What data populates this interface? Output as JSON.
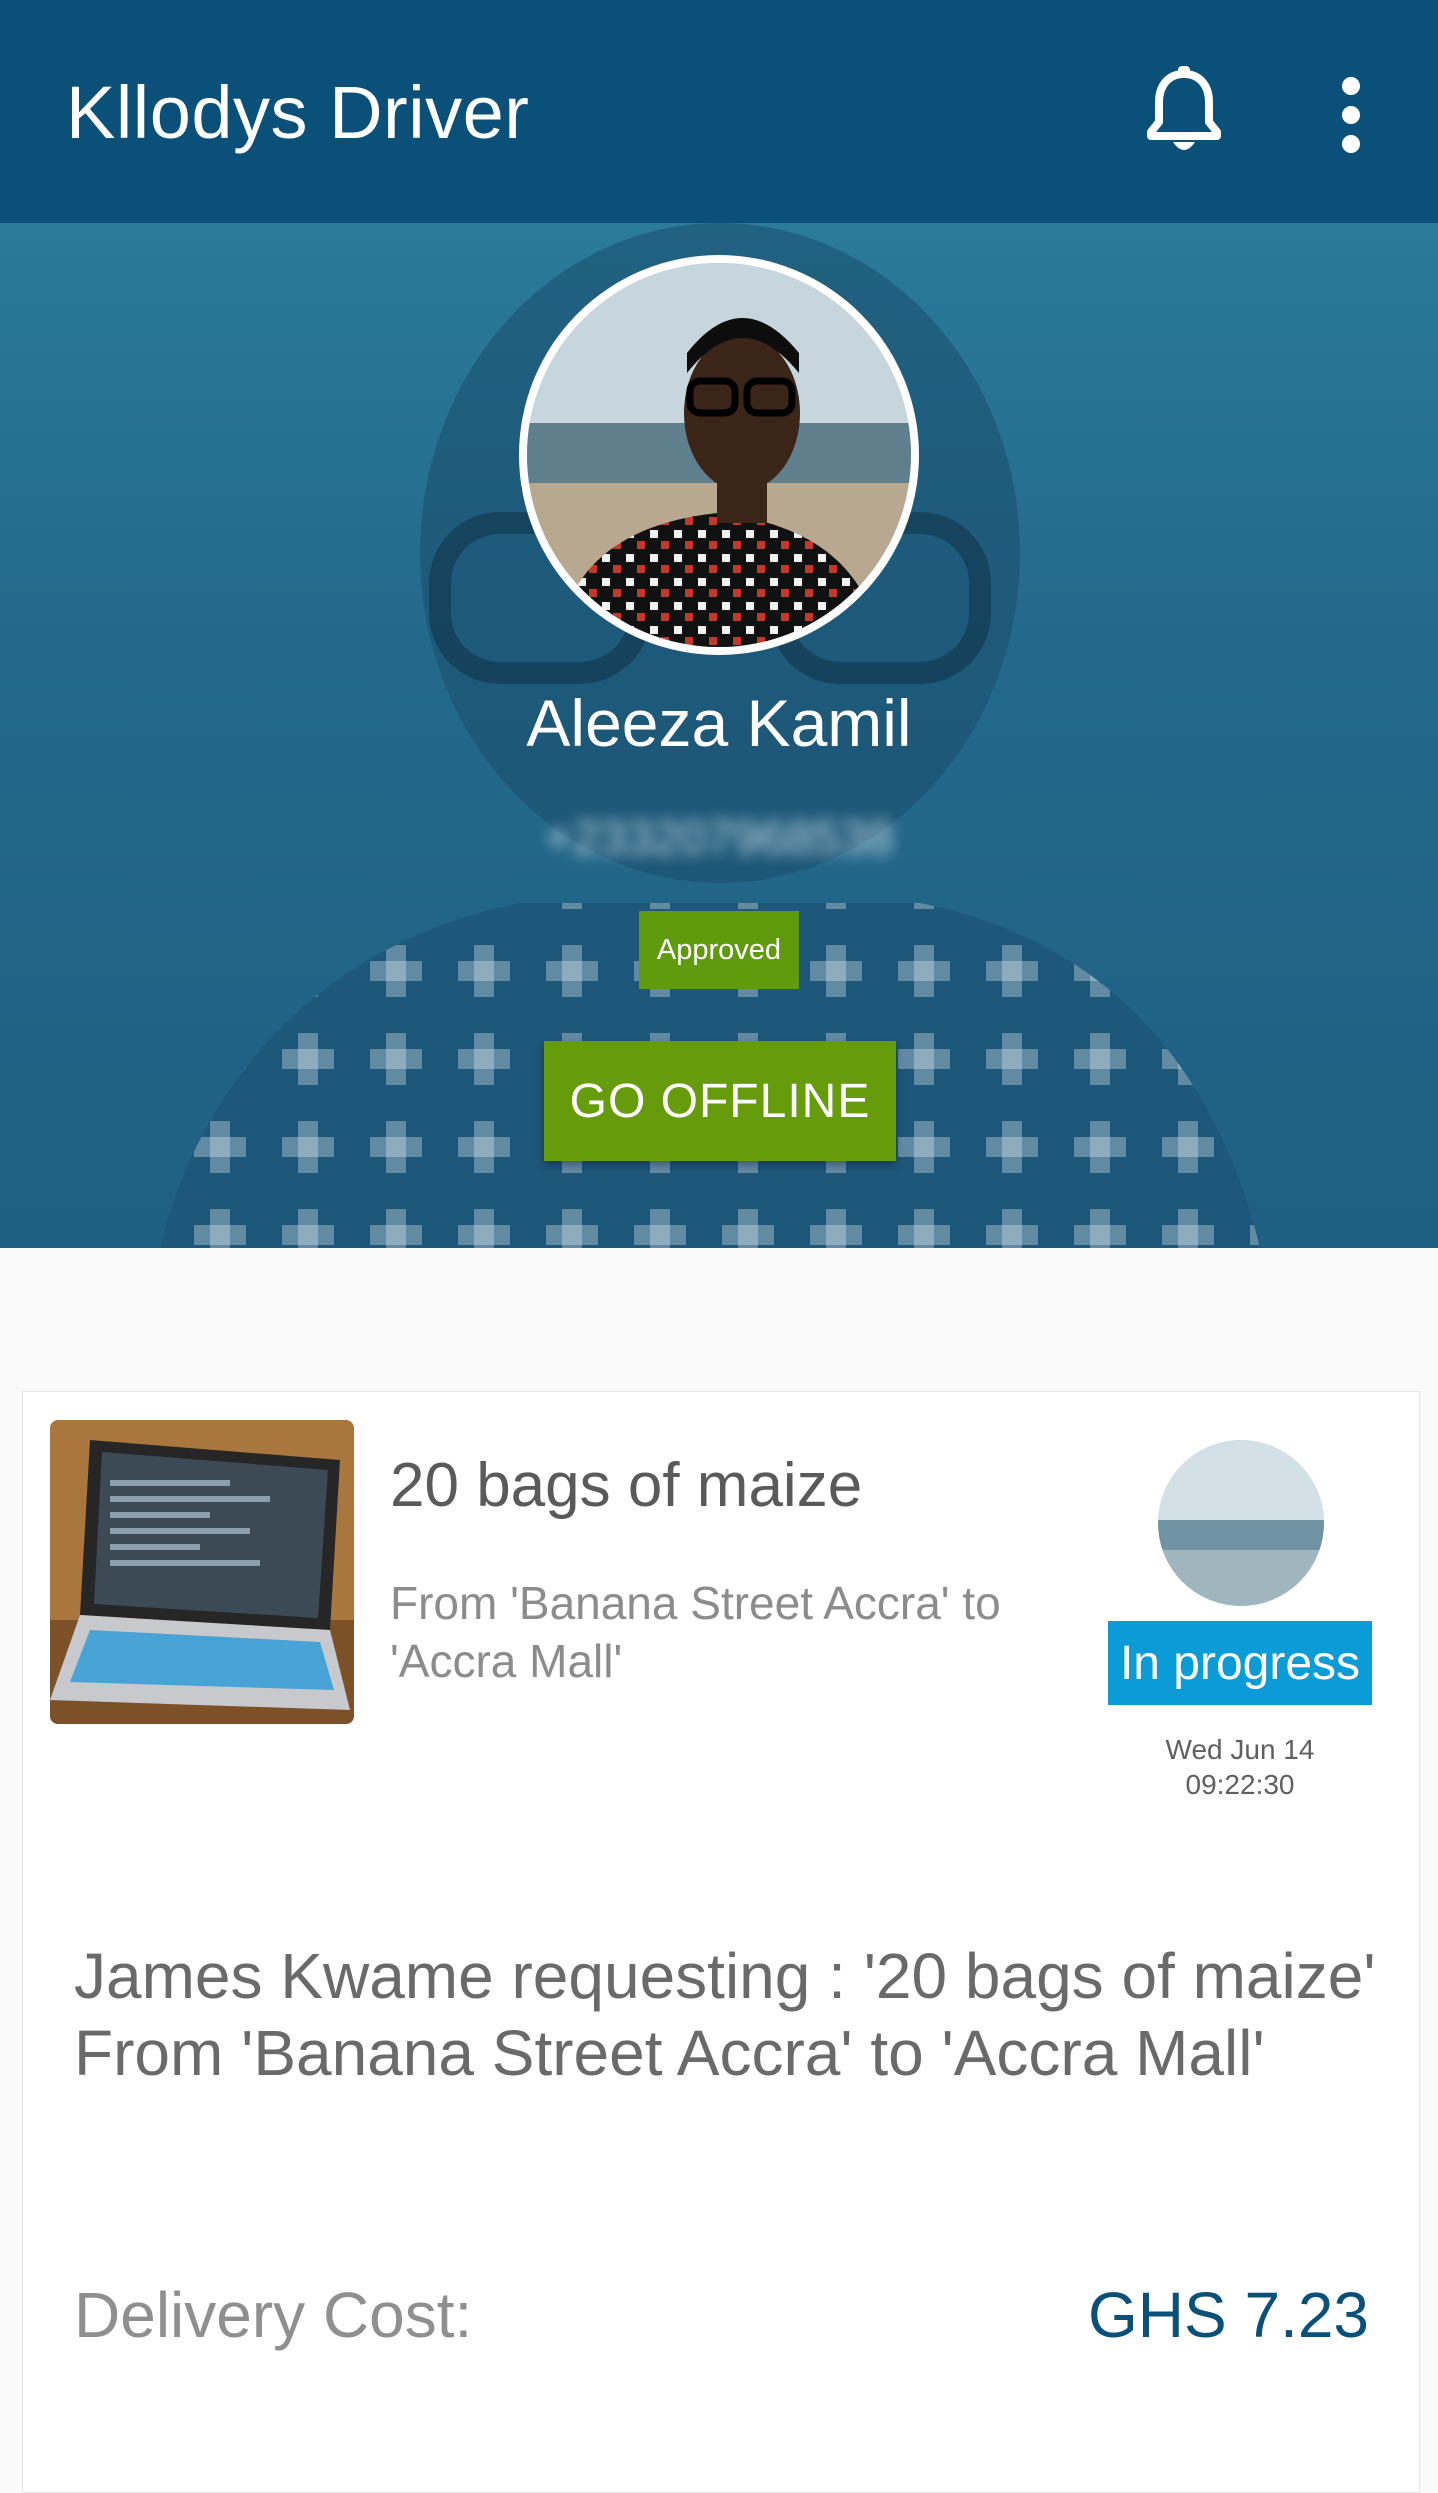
{
  "app_bar": {
    "title": "Kllodys Driver",
    "icons": [
      "bell-icon",
      "more-vert-icon"
    ]
  },
  "profile": {
    "name": "Aleeza Kamil",
    "phone": "+233207968538",
    "status_badge": "Approved",
    "action_button": "GO OFFLINE"
  },
  "delivery_card": {
    "title": "20 bags of maize",
    "route": "From 'Banana Street Accra' to 'Accra Mall'",
    "status": "In progress",
    "date": "Wed Jun 14",
    "time": "09:22:30",
    "request_text": "James Kwame requesting : '20 bags of maize' From 'Banana Street Accra' to 'Accra Mall'",
    "cost_label": "Delivery Cost:",
    "cost_value": "GHS 7.23"
  },
  "colors": {
    "primary": "#0b5078",
    "hero_overlay": "#23698b",
    "approved": "#5f9b0c",
    "go_offline": "#669b0b",
    "in_progress": "#0b9bd6"
  }
}
